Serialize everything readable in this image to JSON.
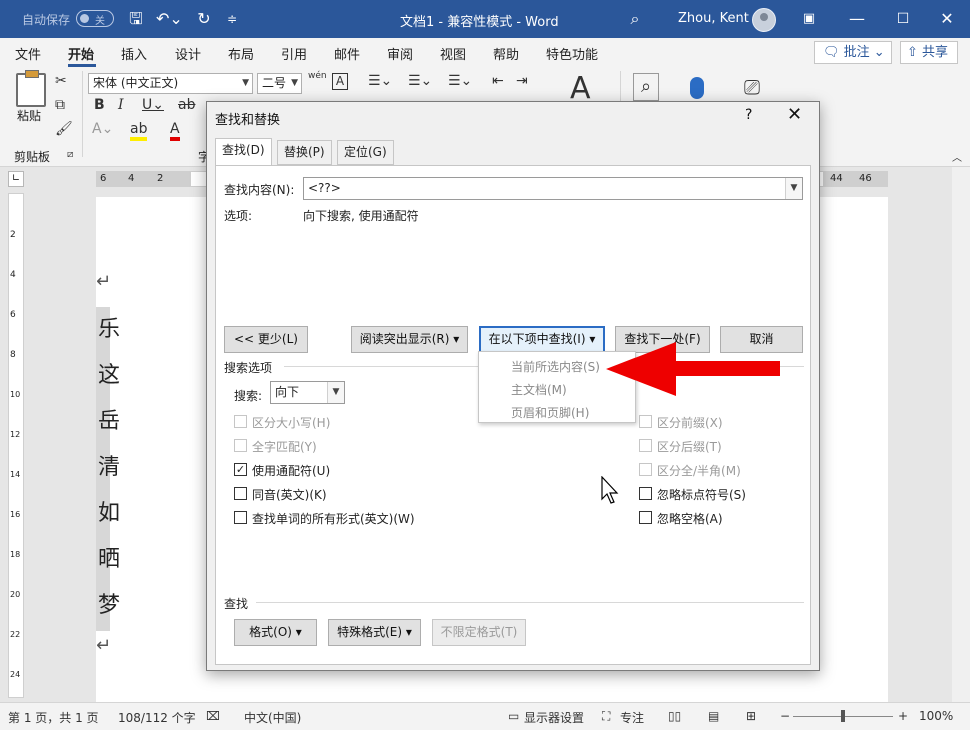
{
  "titlebar": {
    "autosave_label": "自动保存",
    "autosave_state": "关",
    "doc_title": "文档1 - 兼容性模式 - Word",
    "user": "Zhou, Kent"
  },
  "ribbon_tabs": [
    "文件",
    "开始",
    "插入",
    "设计",
    "布局",
    "引用",
    "邮件",
    "审阅",
    "视图",
    "帮助",
    "特色功能"
  ],
  "active_tab": "开始",
  "comment_label": "批注",
  "share_label": "共享",
  "ribbon": {
    "paste_label": "粘贴",
    "clipboard_label": "剪贴板",
    "font_name": "宋体 (中文正文)",
    "font_size": "二号",
    "font_group_partial": "字",
    "wen_label": "wén"
  },
  "ruler": {
    "left_ticks": [
      "6",
      "4",
      "2"
    ],
    "right_ticks": [
      "44",
      "46"
    ],
    "vertical_ticks": [
      "2",
      "4",
      "6",
      "8",
      "10",
      "12",
      "14",
      "16",
      "18",
      "20",
      "22",
      "24"
    ]
  },
  "document": {
    "chars": [
      "乐",
      "这",
      "岳",
      "清",
      "如",
      "晒",
      "梦"
    ]
  },
  "dialog": {
    "title": "查找和替换",
    "help": "?",
    "close": "✕",
    "tabs": [
      "查找(D)",
      "替换(P)",
      "定位(G)"
    ],
    "find_label": "查找内容(N):",
    "find_value": "<??>",
    "options_label": "选项:",
    "options_value": "向下搜索, 使用通配符",
    "less_button": "<< 更少(L)",
    "reading_highlight_button": "阅读突出显示(R) ▾",
    "find_in_button": "在以下项中查找(I) ▾",
    "find_next_button": "查找下一处(F)",
    "cancel_button": "取消",
    "search_options_title": "搜索选项",
    "search_label": "搜索:",
    "search_value": "向下",
    "left_options": [
      {
        "label": "区分大小写(H)",
        "checked": false,
        "enabled": false
      },
      {
        "label": "全字匹配(Y)",
        "checked": false,
        "enabled": false
      },
      {
        "label": "使用通配符(U)",
        "checked": true,
        "enabled": true
      },
      {
        "label": "同音(英文)(K)",
        "checked": false,
        "enabled": true
      },
      {
        "label": "查找单词的所有形式(英文)(W)",
        "checked": false,
        "enabled": true
      }
    ],
    "right_options": [
      {
        "label": "区分前缀(X)",
        "checked": false,
        "enabled": false
      },
      {
        "label": "区分后缀(T)",
        "checked": false,
        "enabled": false
      },
      {
        "label": "区分全/半角(M)",
        "checked": false,
        "enabled": false
      },
      {
        "label": "忽略标点符号(S)",
        "checked": false,
        "enabled": true
      },
      {
        "label": "忽略空格(A)",
        "checked": false,
        "enabled": true
      }
    ],
    "find_section_title": "查找",
    "format_button": "格式(O) ▾",
    "special_button": "特殊格式(E) ▾",
    "no_format_button": "不限定格式(T)"
  },
  "find_in_menu": [
    "当前所选内容(S)",
    "主文档(M)",
    "页眉和页脚(H)"
  ],
  "statusbar": {
    "page": "第 1 页，共 1 页",
    "words": "108/112 个字",
    "language": "中文(中国)",
    "display_settings": "显示器设置",
    "focus": "专注",
    "zoom": "100%"
  },
  "colors": {
    "titlebar": "#2b579a",
    "arrow": "#ee0000",
    "focus_border": "#2b6cc4"
  }
}
